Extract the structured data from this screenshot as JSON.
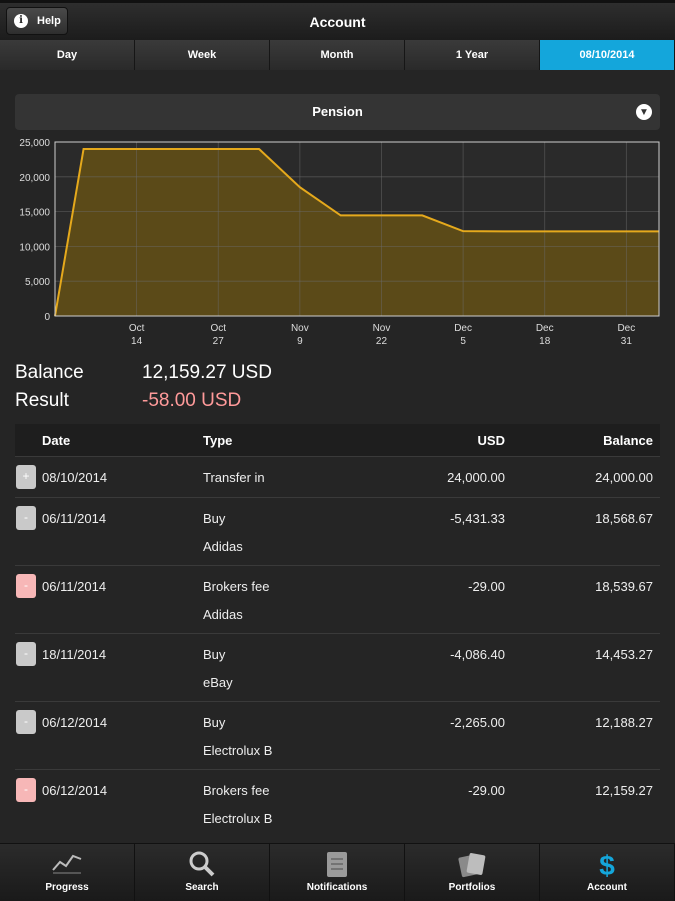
{
  "header": {
    "help_label": "Help",
    "title": "Account"
  },
  "tabs": [
    {
      "label": "Day"
    },
    {
      "label": "Week"
    },
    {
      "label": "Month"
    },
    {
      "label": "1 Year"
    },
    {
      "label": "08/10/2014",
      "active": true
    }
  ],
  "selector": {
    "label": "Pension"
  },
  "summary": {
    "balance_label": "Balance",
    "balance_value": "12,159.27 USD",
    "result_label": "Result",
    "result_value": "-58.00 USD",
    "result_color": "#ff9a9a"
  },
  "table": {
    "headers": {
      "date": "Date",
      "type": "Type",
      "usd": "USD",
      "balance": "Balance"
    },
    "rows": [
      {
        "sign": "+",
        "date": "08/10/2014",
        "type": "Transfer in",
        "sub": "",
        "usd": "24,000.00",
        "balance": "24,000.00",
        "color": "grey"
      },
      {
        "sign": "-",
        "date": "06/11/2014",
        "type": "Buy",
        "sub": "Adidas",
        "usd": "-5,431.33",
        "balance": "18,568.67",
        "color": "grey"
      },
      {
        "sign": "-",
        "date": "06/11/2014",
        "type": "Brokers fee",
        "sub": "Adidas",
        "usd": "-29.00",
        "balance": "18,539.67",
        "color": "pink"
      },
      {
        "sign": "-",
        "date": "18/11/2014",
        "type": "Buy",
        "sub": "eBay",
        "usd": "-4,086.40",
        "balance": "14,453.27",
        "color": "grey"
      },
      {
        "sign": "-",
        "date": "06/12/2014",
        "type": "Buy",
        "sub": "Electrolux B",
        "usd": "-2,265.00",
        "balance": "12,188.27",
        "color": "grey"
      },
      {
        "sign": "-",
        "date": "06/12/2014",
        "type": "Brokers fee",
        "sub": "Electrolux B",
        "usd": "-29.00",
        "balance": "12,159.27",
        "color": "pink"
      }
    ]
  },
  "bottom_nav": [
    {
      "label": "Progress",
      "icon": "progress-chart-icon"
    },
    {
      "label": "Search",
      "icon": "magnifier-icon"
    },
    {
      "label": "Notifications",
      "icon": "notepad-icon"
    },
    {
      "label": "Portfolios",
      "icon": "cards-icon"
    },
    {
      "label": "Account",
      "icon": "dollar-icon"
    }
  ],
  "chart_data": {
    "type": "area",
    "x": [
      0,
      7,
      50,
      60,
      70,
      80,
      90,
      100,
      110,
      148
    ],
    "y": [
      0,
      24000,
      24000,
      18500,
      14450,
      14450,
      14450,
      12188,
      12159,
      12159
    ],
    "xlim": [
      0,
      148
    ],
    "ylim": [
      0,
      25000
    ],
    "yticks": [
      0,
      5000,
      10000,
      15000,
      20000,
      25000
    ],
    "ytick_labels": [
      "0",
      "5,000",
      "10,000",
      "15,000",
      "20,000",
      "25,000"
    ],
    "xticks": [
      20,
      40,
      60,
      80,
      100,
      120,
      140
    ],
    "xtick_labels": [
      [
        "Oct",
        "14"
      ],
      [
        "Oct",
        "27"
      ],
      [
        "Nov",
        "9"
      ],
      [
        "Nov",
        "22"
      ],
      [
        "Dec",
        "5"
      ],
      [
        "Dec",
        "18"
      ],
      [
        "Dec",
        "31"
      ]
    ],
    "grid": true,
    "line_color": "#e5a91c",
    "fill_color": "#5b4a18"
  }
}
